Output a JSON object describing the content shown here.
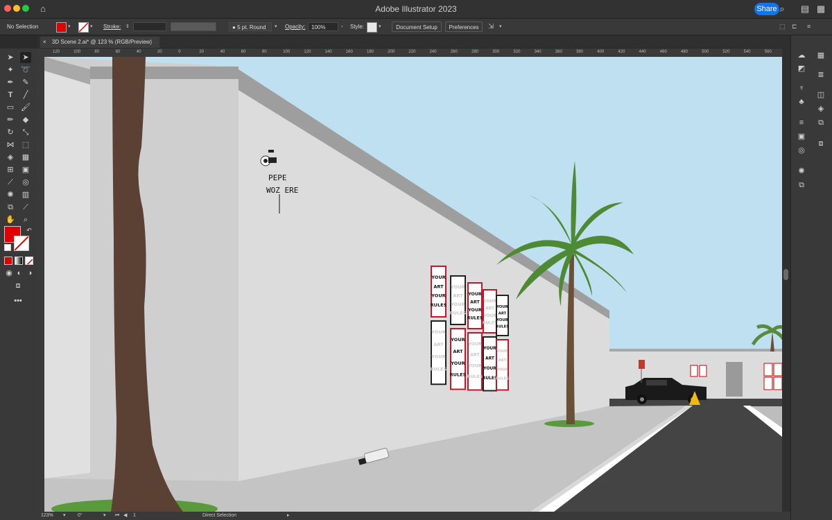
{
  "window": {
    "title": "Adobe Illustrator 2023",
    "share_label": "Share"
  },
  "control_bar": {
    "selection_label": "No Selection",
    "fill_color": "#e00000",
    "stroke_label": "Stroke:",
    "brush_label": "5 pt. Round",
    "opacity_label": "Opacity:",
    "opacity_value": "100%",
    "style_label": "Style:",
    "document_setup": "Document Setup",
    "preferences": "Preferences"
  },
  "document_tab": {
    "label": "3D Scene 2.ai* @ 123 % (RGB/Preview)",
    "close": "×"
  },
  "ruler_ticks": [
    "120",
    "100",
    "80",
    "60",
    "40",
    "20",
    "0",
    "20",
    "40",
    "60",
    "80",
    "100",
    "120",
    "140",
    "160",
    "180",
    "200",
    "220",
    "240",
    "260",
    "280",
    "300",
    "320",
    "340",
    "360",
    "380",
    "400",
    "420",
    "440",
    "460",
    "480",
    "500",
    "520",
    "540",
    "560"
  ],
  "artwork": {
    "graffiti_line1": "PEPE",
    "graffiti_line2": "WOZ ERE",
    "poster_text": [
      "YOUR",
      "ART",
      "YOUR",
      "RULES"
    ]
  },
  "status_bar": {
    "zoom": "123%",
    "rotation": "0°",
    "artboard": "1",
    "tool": "Direct Selection"
  },
  "colors": {
    "accent": "#1473e6",
    "fill": "#e00000",
    "sky": "#bfe0f0",
    "wall": "#dcdcdc"
  }
}
